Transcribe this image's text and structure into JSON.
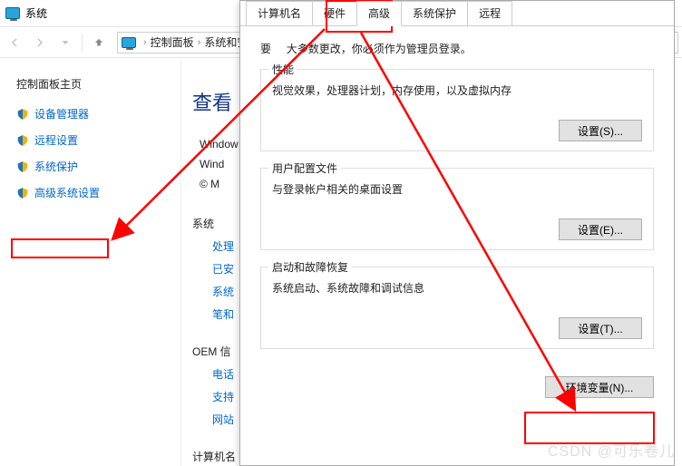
{
  "title": "系统",
  "breadcrumb": {
    "item1": "控制面板",
    "item2": "系统和安"
  },
  "leftpanel": {
    "home": "控制面板主页",
    "items": [
      {
        "label": "设备管理器"
      },
      {
        "label": "远程设置"
      },
      {
        "label": "系统保护"
      },
      {
        "label": "高级系统设置"
      }
    ]
  },
  "right": {
    "heading": "查看",
    "winline1": "Window",
    "winline2": "Wind",
    "winline3": "© M",
    "syslabel": "系统",
    "sysitems": [
      "处理",
      "已安",
      "系统",
      "笔和"
    ],
    "oemlabel": "OEM 信",
    "oemitems": [
      "电话",
      "支持",
      "网站"
    ],
    "complabel": "计算机名"
  },
  "dialog": {
    "tabs": [
      "计算机名",
      "硬件",
      "高级",
      "系统保护",
      "远程"
    ],
    "active_tab_index": 2,
    "admin_note_prefix": "要",
    "admin_note_rest": "大多数更改，你必须作为管理员登录。",
    "groups": [
      {
        "legend": "性能",
        "desc": "视觉效果，处理器计划，内存使用，以及虚拟内存",
        "button": "设置(S)..."
      },
      {
        "legend": "用户配置文件",
        "desc": "与登录帐户相关的桌面设置",
        "button": "设置(E)..."
      },
      {
        "legend": "启动和故障恢复",
        "desc": "系统启动、系统故障和调试信息",
        "button": "设置(T)..."
      }
    ],
    "env_button": "环境变量(N)..."
  },
  "watermark": "CSDN @可乐卷儿"
}
